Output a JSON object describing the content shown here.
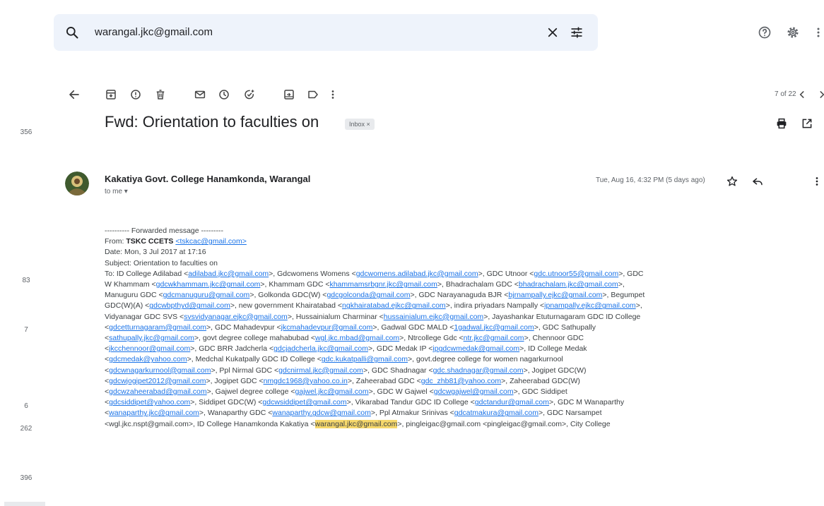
{
  "search": {
    "query": "warangal.jkc@gmail.com"
  },
  "rail_counts": [
    "356",
    "83",
    "7",
    "6",
    "262",
    "396"
  ],
  "pager": {
    "text": "7 of 22"
  },
  "email": {
    "subject": "Fwd: Orientation to faculties on",
    "label_chip": "Inbox ×",
    "sender": "Kakatiya Govt. College Hanamkonda, Warangal",
    "to": "to me ▾",
    "date": "Tue, Aug 16, 4:32 PM (5 days ago)"
  },
  "body": {
    "forward_line": "---------- Forwarded message ---------",
    "from_label": "From:",
    "from_name": "TSKC CCETS",
    "from_email": "<tskcac@gmail.com>",
    "date_line": "Date: Mon, 3 Jul 2017 at 17:16",
    "subject_line": "Subject: Orientation to faculties on",
    "to_lines": [
      [
        [
          "t",
          "To: ID College Adilabad <"
        ],
        [
          "l",
          "adilabad.jkc@gmail.com"
        ],
        [
          "t",
          ">, Gdcwomens Womens <"
        ],
        [
          "l",
          "gdcwomens.adilabad.jkc@gmail.com"
        ],
        [
          "t",
          ">, GDC Utnoor <"
        ],
        [
          "l",
          "gdc.utnoor55@gmail.com"
        ],
        [
          "t",
          ">, GDC"
        ]
      ],
      [
        [
          "t",
          "W Khammam <"
        ],
        [
          "l",
          "gdcwkhammam.jkc@gmail.com"
        ],
        [
          "t",
          ">, Khammam GDC <"
        ],
        [
          "l",
          "khammamsrbgnr.jkc@gmail.com"
        ],
        [
          "t",
          ">, Bhadrachalam GDC <"
        ],
        [
          "l",
          "bhadrachalam.jkc@gmail.com"
        ],
        [
          "t",
          ">,"
        ]
      ],
      [
        [
          "t",
          "Manuguru GDC <"
        ],
        [
          "l",
          "gdcmanuguru@gmail.com"
        ],
        [
          "t",
          ">, Golkonda GDC(W) <"
        ],
        [
          "l",
          "gdcgolconda@gmail.com"
        ],
        [
          "t",
          ">, GDC Narayanaguda BJR <"
        ],
        [
          "l",
          "bjrnampally.ejkc@gmail.com"
        ],
        [
          "t",
          ">, Begumpet"
        ]
      ],
      [
        [
          "t",
          "GDC(W)(A) <"
        ],
        [
          "l",
          "gdcwbpthyd@gmail.com"
        ],
        [
          "t",
          ">, new government Khairatabad <"
        ],
        [
          "l",
          "ngkhairatabad.ejkc@gmail.com"
        ],
        [
          "t",
          ">, indira priyadars Nampally <"
        ],
        [
          "l",
          "ipnampally.ejkc@gmail.com"
        ],
        [
          "t",
          ">,"
        ]
      ],
      [
        [
          "t",
          "Vidyanagar GDC SVS <"
        ],
        [
          "l",
          "svsvidyanagar.ejkc@gmail.com"
        ],
        [
          "t",
          ">, Hussainialum Charminar <"
        ],
        [
          "l",
          "hussainialum.ejkc@gmail.com"
        ],
        [
          "t",
          ">, Jayashankar Etuturnagaram GDC ID College"
        ]
      ],
      [
        [
          "t",
          "<"
        ],
        [
          "l",
          "gdcetturnagaram@gmail.com"
        ],
        [
          "t",
          ">, GDC Mahadevpur <"
        ],
        [
          "l",
          "jkcmahadevpur@gmail.com"
        ],
        [
          "t",
          ">, Gadwal GDC MALD <"
        ],
        [
          "l",
          "1gadwal.jkc@gmail.com"
        ],
        [
          "t",
          ">, GDC Sathupally"
        ]
      ],
      [
        [
          "t",
          "<"
        ],
        [
          "l",
          "sathupally.jkc@gmail.com"
        ],
        [
          "t",
          ">, govt degree college mahabubad <"
        ],
        [
          "l",
          "wgl.jkc.mbad@gmail.com"
        ],
        [
          "t",
          ">, Ntrcollege Gdc <"
        ],
        [
          "l",
          "ntr.jkc@gmail.com"
        ],
        [
          "t",
          ">, Chennoor GDC"
        ]
      ],
      [
        [
          "t",
          "<"
        ],
        [
          "l",
          "jkcchennoor@gmail.com"
        ],
        [
          "t",
          ">, GDC BRR Jadcherla <"
        ],
        [
          "l",
          "gdcjadcherla.jkc@gmail.com"
        ],
        [
          "t",
          ">, GDC Medak IP <"
        ],
        [
          "l",
          "ipgdcwmedak@gmail.com"
        ],
        [
          "t",
          ">, ID College Medak"
        ]
      ],
      [
        [
          "t",
          "<"
        ],
        [
          "l",
          "gdcmedak@yahoo.com"
        ],
        [
          "t",
          ">, Medchal Kukatpally GDC ID College <"
        ],
        [
          "l",
          "gdc.kukatpalli@gmail.com"
        ],
        [
          "t",
          ">, govt.degree college for women nagarkurnool"
        ]
      ],
      [
        [
          "t",
          "<"
        ],
        [
          "l",
          "gdcwnagarkurnool@gmail.com"
        ],
        [
          "t",
          ">, Ppl Nirmal GDC <"
        ],
        [
          "l",
          "gdcnirmal.jkc@gmail.com"
        ],
        [
          "t",
          ">, GDC Shadnagar <"
        ],
        [
          "l",
          "gdc.shadnagar@gmail.com"
        ],
        [
          "t",
          ">, Jogipet GDC(W)"
        ]
      ],
      [
        [
          "t",
          "<"
        ],
        [
          "l",
          "gdcwjogipet2012@gmail.com"
        ],
        [
          "t",
          ">, Jogipet GDC <"
        ],
        [
          "l",
          "nmgdc1968@yahoo.co.in"
        ],
        [
          "t",
          ">, Zaheerabad GDC <"
        ],
        [
          "l",
          "gdc_zhb81@yahoo.com"
        ],
        [
          "t",
          ">, Zaheerabad GDC(W)"
        ]
      ],
      [
        [
          "t",
          "<"
        ],
        [
          "l",
          "gdcwzaheerabad@gmail.com"
        ],
        [
          "t",
          ">, Gajwel degree college <"
        ],
        [
          "l",
          "gajwel.jkc@gmail.com"
        ],
        [
          "t",
          ">, GDC W Gajwel <"
        ],
        [
          "l",
          "gdcwgajwel@gmail.com"
        ],
        [
          "t",
          ">, GDC Siddipet"
        ]
      ],
      [
        [
          "t",
          "<"
        ],
        [
          "l",
          "gdcsiddipet@yahoo.com"
        ],
        [
          "t",
          ">, Siddipet GDC(W) <"
        ],
        [
          "l",
          "gdcwsiddipet@gmail.com"
        ],
        [
          "t",
          ">, Vikarabad Tandur GDC ID College <"
        ],
        [
          "l",
          "gdctandur@gmail.com"
        ],
        [
          "t",
          ">, GDC M Wanaparthy"
        ]
      ],
      [
        [
          "t",
          "<"
        ],
        [
          "l",
          "wanaparthy.jkc@gmail.com"
        ],
        [
          "t",
          ">, Wanaparthy GDC <"
        ],
        [
          "l",
          "wanaparthy.gdcw@gmail.com"
        ],
        [
          "t",
          ">, Ppl Atmakur Srinivas <"
        ],
        [
          "l",
          "gdcatmakura@gmail.com"
        ],
        [
          "t",
          ">, GDC Narsampet"
        ]
      ],
      [
        [
          "t",
          "<wgl.jkc.nspt@gmail.com>, ID College Hanamkonda Kakatiya <"
        ],
        [
          "h",
          "warangal.jkc@gmail.com"
        ],
        [
          "t",
          ">, pingleigac@gmail.com <pingleigac@gmail.com>, City College"
        ]
      ]
    ]
  },
  "colors": {
    "accent": "#1a73e8",
    "highlight": "#f6d86b",
    "search_bg": "#eef3fb"
  }
}
